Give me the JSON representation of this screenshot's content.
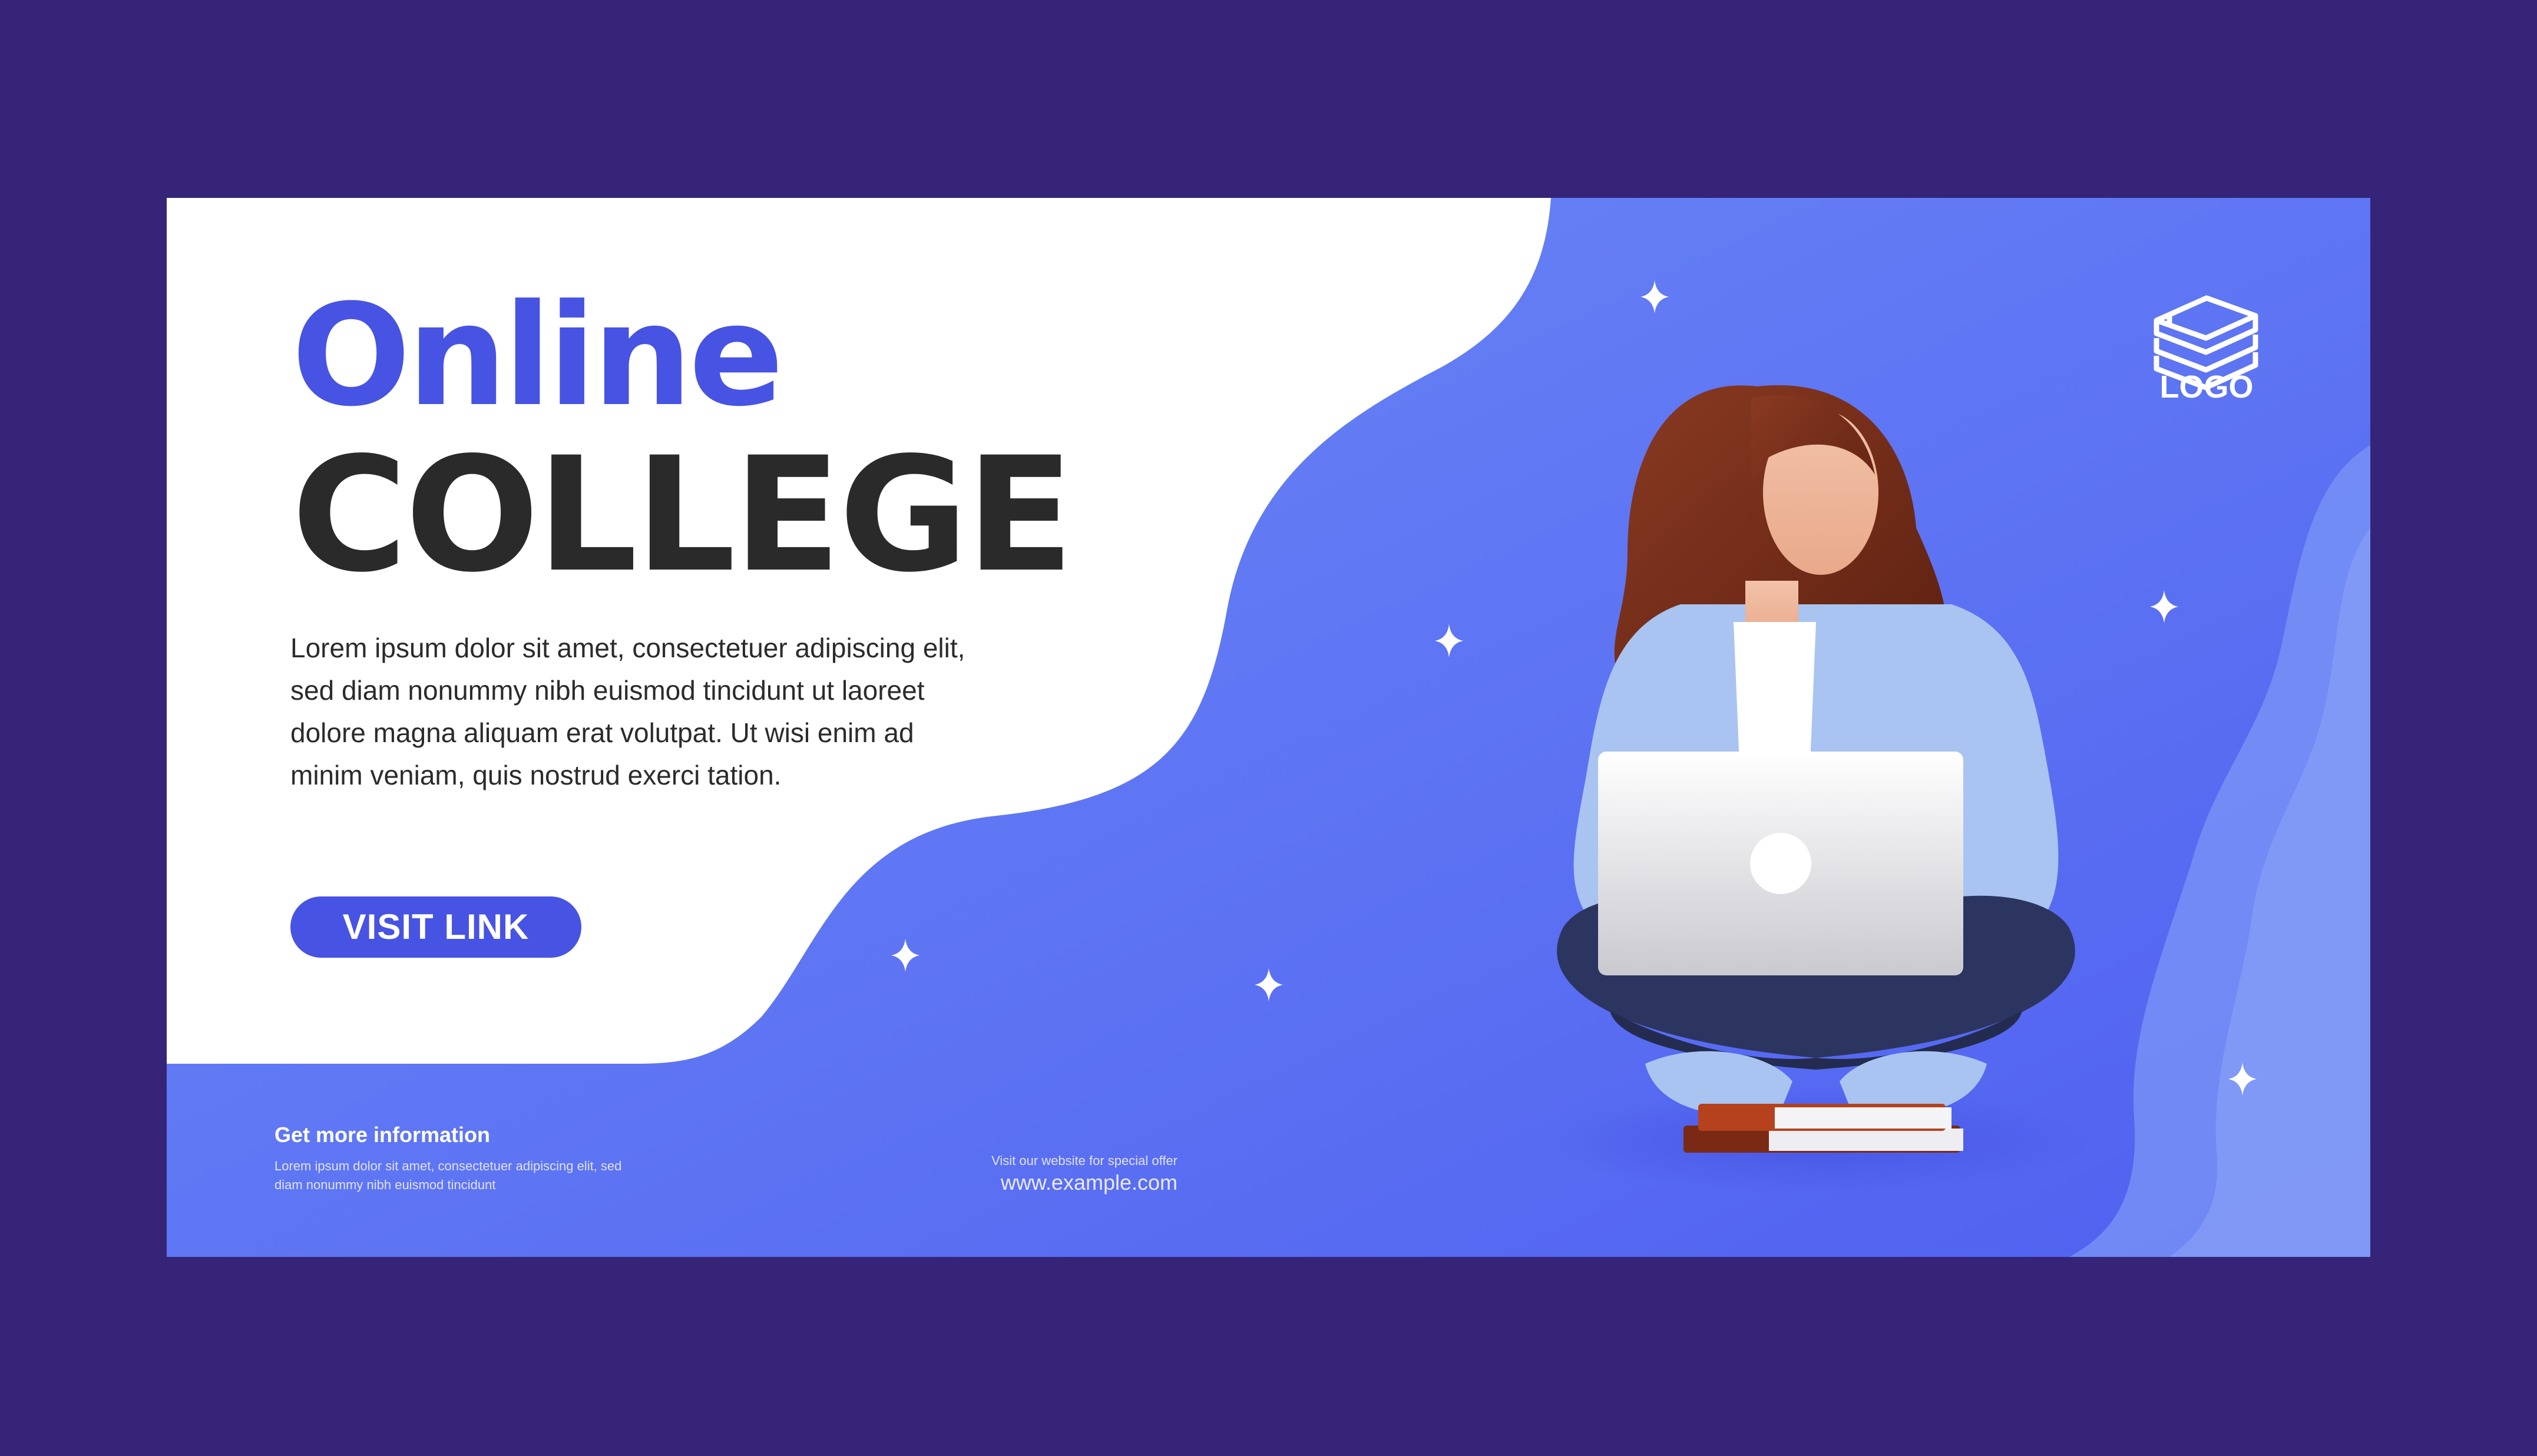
{
  "headline": {
    "line1": "Online",
    "line2": "COLLEGE"
  },
  "description": [
    "Lorem ipsum dolor sit amet, consectetuer adipiscing elit,",
    "sed diam nonummy nibh euismod tincidunt ut laoreet",
    "dolore magna aliquam erat volutpat. Ut wisi enim ad",
    "minim veniam, quis nostrud exerci tation."
  ],
  "cta": {
    "label": "VISIT LINK"
  },
  "footer": {
    "info_heading": "Get more information",
    "info_text": [
      "Lorem ipsum dolor sit amet, consectetuer adipiscing elit, sed",
      "diam nonummy nibh euismod tincidunt"
    ],
    "offer_text": "Visit our website for special offer",
    "website": "www.example.com"
  },
  "logo": {
    "label": "LOGO",
    "icon": "stacked-books-icon"
  },
  "illustration": {
    "subject": "woman-with-laptop-icon",
    "decorations": "sparkle-icon"
  },
  "colors": {
    "background": "#352477",
    "accent": "#4753e2",
    "panel_blue": "#5b66f3",
    "heading_dark": "#2a2a2a",
    "white": "#ffffff"
  }
}
